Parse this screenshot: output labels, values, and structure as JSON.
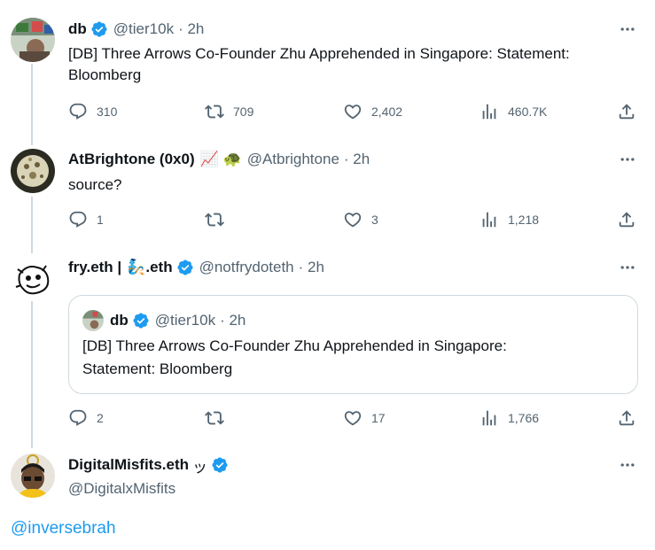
{
  "tweets": [
    {
      "name": "db",
      "handle": "@tier10k",
      "time": "· 2h",
      "text": "[DB] Three Arrows Co-Founder Zhu Apprehended in Singapore: Statement: Bloomberg",
      "replies": "310",
      "retweets": "709",
      "likes": "2,402",
      "views": "460.7K",
      "verified": true
    },
    {
      "name": "AtBrightone (0x0)",
      "name_emoji": "📈 🐢",
      "handle": "@Atbrightone",
      "time": "· 2h",
      "text": "source?",
      "replies": "1",
      "retweets": "",
      "likes": "3",
      "views": "1,218",
      "verified": false
    },
    {
      "name": "fry.eth |",
      "name_emoji": "🧞",
      "name_suffix": ".eth",
      "handle": "@notfrydoteth",
      "time": "· 2h",
      "replies": "2",
      "retweets": "",
      "likes": "17",
      "views": "1,766",
      "verified": true,
      "quote": {
        "name": "db",
        "handle": "@tier10k",
        "time": "· 2h",
        "text": "[DB] Three Arrows Co-Founder Zhu Apprehended in Singapore: Statement: Bloomberg"
      }
    },
    {
      "name": "DigitalMisfits.eth",
      "name_glyph": "ッ",
      "handle": "@DigitalxMisfits",
      "verified": true
    }
  ],
  "reply_link": "@inversebrah",
  "colors": {
    "verified": "#1d9bf0",
    "link": "#1d9bf0",
    "muted": "#536471",
    "border": "#cfd9de"
  }
}
